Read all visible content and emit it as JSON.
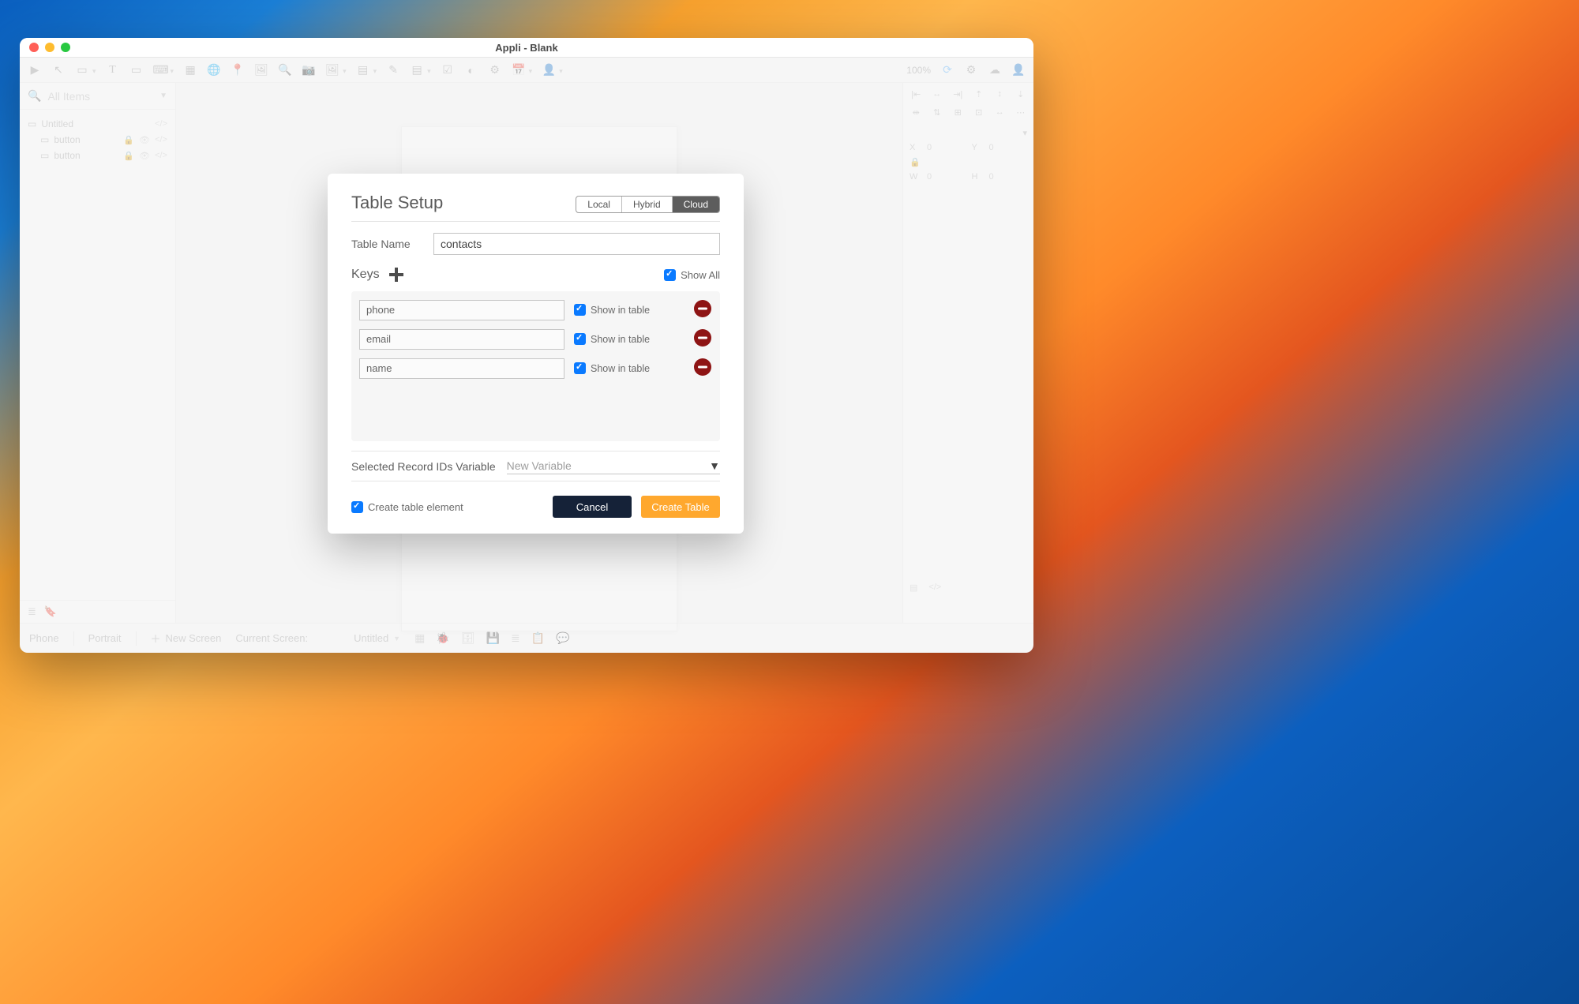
{
  "window": {
    "title": "Appli - Blank"
  },
  "toolbar": {
    "zoom": "100%"
  },
  "sidebar": {
    "search_placeholder": "All Items",
    "tree": {
      "root": "Untitled",
      "items": [
        "button",
        "button"
      ]
    }
  },
  "right_panel": {
    "x_label": "X",
    "x_value": "0",
    "y_label": "Y",
    "y_value": "0",
    "w_label": "W",
    "w_value": "0",
    "h_label": "H",
    "h_value": "0"
  },
  "statusbar": {
    "device": "Phone",
    "orientation": "Portrait",
    "new_screen": "New Screen",
    "current_screen_label": "Current Screen:",
    "current_screen_value": "Untitled"
  },
  "modal": {
    "title": "Table Setup",
    "segments": {
      "local": "Local",
      "hybrid": "Hybrid",
      "cloud": "Cloud",
      "active": "cloud"
    },
    "table_name_label": "Table Name",
    "table_name_value": "contacts",
    "keys_label": "Keys",
    "show_all_label": "Show All",
    "keys": [
      {
        "name": "phone",
        "show_label": "Show in table"
      },
      {
        "name": "email",
        "show_label": "Show in table"
      },
      {
        "name": "name",
        "show_label": "Show in table"
      }
    ],
    "variable_label": "Selected Record IDs Variable",
    "variable_placeholder": "New Variable",
    "create_element_label": "Create table element",
    "cancel_label": "Cancel",
    "create_label": "Create Table"
  }
}
